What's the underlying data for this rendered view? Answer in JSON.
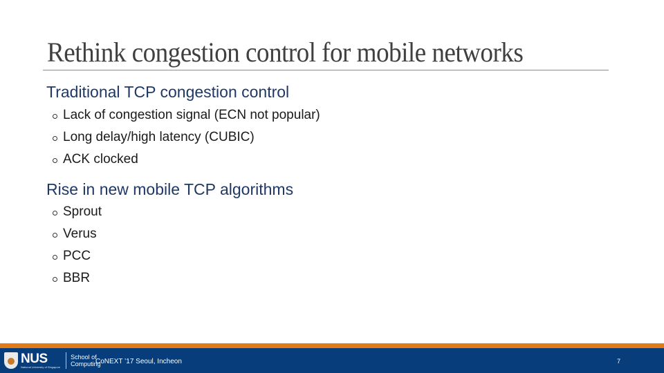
{
  "slide": {
    "title": "Rethink congestion control for mobile networks",
    "sections": [
      {
        "heading": "Traditional TCP congestion control",
        "bullets": [
          "Lack of congestion signal (ECN not popular)",
          "Long delay/high latency (CUBIC)",
          "ACK clocked"
        ]
      },
      {
        "heading": "Rise in new mobile TCP algorithms",
        "bullets": [
          "Sprout",
          "Verus",
          "PCC",
          "BBR"
        ]
      }
    ]
  },
  "footer": {
    "logo_text": "NUS",
    "logo_subtext": "National University of Singapore",
    "school_line1": "School of",
    "school_line2": "Computing",
    "conference": "CoNEXT ’17 Seoul, Incheon",
    "page_number": "7",
    "colors": {
      "accent_bar": "#e07b17",
      "footer_bg": "#063d7a",
      "heading": "#1f3864"
    }
  }
}
